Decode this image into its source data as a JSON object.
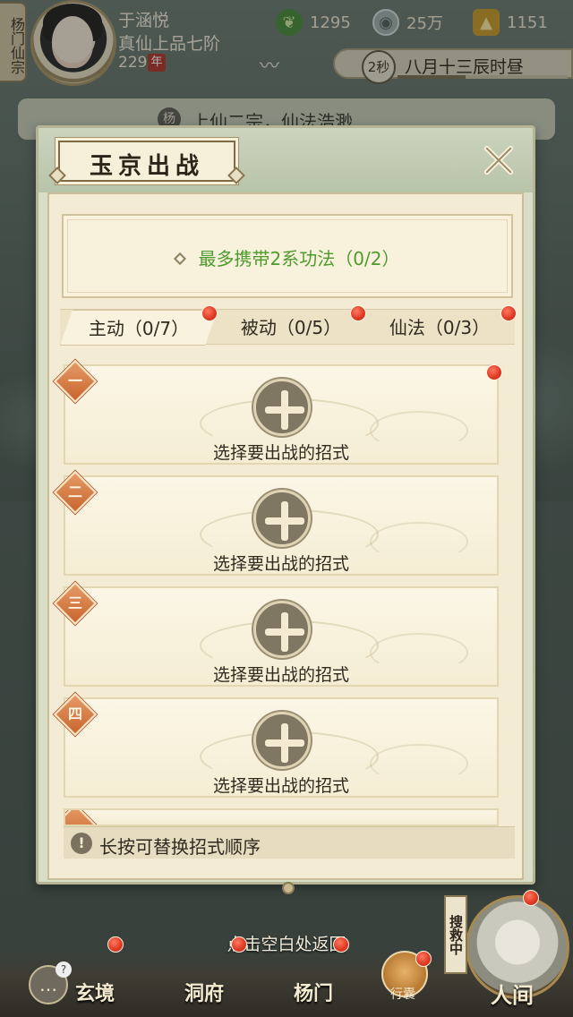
{
  "player": {
    "sect_tag": "杨门仙宗",
    "name": "于涵悦",
    "rank": "真仙上品七阶",
    "age": "229",
    "age_unit": "年"
  },
  "resources": {
    "leaf": "1295",
    "coin": "25万",
    "ingot": "1151"
  },
  "time": {
    "seconds": "2秒",
    "label": "八月十三辰时昼"
  },
  "behind_notice": {
    "avatar_char": "杨",
    "text": "上仙二宗，仙法浩渺"
  },
  "dialog": {
    "title": "玉京出战",
    "info": "最多携带2系功法（0/2）",
    "tabs": [
      {
        "label": "主动（0/7）",
        "active": true
      },
      {
        "label": "被动（0/5）",
        "active": false
      },
      {
        "label": "仙法（0/3）",
        "active": false
      }
    ],
    "slots": [
      {
        "num": "一",
        "label": "选择要出战的招式"
      },
      {
        "num": "二",
        "label": "选择要出战的招式"
      },
      {
        "num": "三",
        "label": "选择要出战的招式"
      },
      {
        "num": "四",
        "label": "选择要出战的招式"
      }
    ],
    "tip": "长按可替换招式顺序"
  },
  "return_hint": "点击空白处返回",
  "bottom_nav": {
    "xuanjing": "玄境",
    "dongfu": "洞府",
    "yangmen": "杨门",
    "bag": "行囊",
    "search": "搜救中",
    "renjian": "人间"
  },
  "colors": {
    "info_green": "#4f9a2e",
    "badge_orange": "#c9652e",
    "red_dot": "#e03c25"
  }
}
